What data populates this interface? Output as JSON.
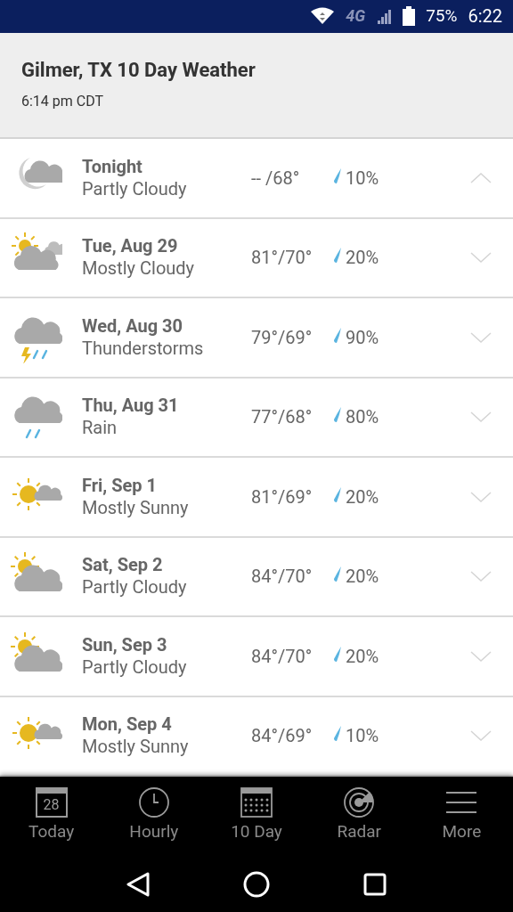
{
  "status_bar": {
    "network": "4G",
    "battery": "75%",
    "time": "6:22"
  },
  "header": {
    "title": "Gilmer, TX 10 Day Weather",
    "updated": "6:14 pm CDT"
  },
  "days": [
    {
      "day": "Tonight",
      "condition": "Partly Cloudy",
      "kind": "night-cloudy",
      "temps": "-- /68°",
      "precip": "10%",
      "expanded": true
    },
    {
      "day": "Tue, Aug 29",
      "condition": "Mostly Cloudy",
      "kind": "mostly-cloudy",
      "temps": "81°/70°",
      "precip": "20%",
      "expanded": false
    },
    {
      "day": "Wed, Aug 30",
      "condition": "Thunderstorms",
      "kind": "thunderstorms",
      "temps": "79°/69°",
      "precip": "90%",
      "expanded": false
    },
    {
      "day": "Thu, Aug 31",
      "condition": "Rain",
      "kind": "rain",
      "temps": "77°/68°",
      "precip": "80%",
      "expanded": false
    },
    {
      "day": "Fri, Sep 1",
      "condition": "Mostly Sunny",
      "kind": "mostly-sunny",
      "temps": "81°/69°",
      "precip": "20%",
      "expanded": false
    },
    {
      "day": "Sat, Sep 2",
      "condition": "Partly Cloudy",
      "kind": "partly-cloudy",
      "temps": "84°/70°",
      "precip": "20%",
      "expanded": false
    },
    {
      "day": "Sun, Sep 3",
      "condition": "Partly Cloudy",
      "kind": "partly-cloudy",
      "temps": "84°/70°",
      "precip": "20%",
      "expanded": false
    },
    {
      "day": "Mon, Sep 4",
      "condition": "Mostly Sunny",
      "kind": "mostly-sunny",
      "temps": "84°/69°",
      "precip": "10%",
      "expanded": false
    }
  ],
  "tabs": [
    {
      "label": "Today",
      "kind": "calendar-day",
      "badge": "28"
    },
    {
      "label": "Hourly",
      "kind": "clock"
    },
    {
      "label": "10 Day",
      "kind": "calendar-grid"
    },
    {
      "label": "Radar",
      "kind": "radar"
    },
    {
      "label": "More",
      "kind": "menu"
    }
  ]
}
